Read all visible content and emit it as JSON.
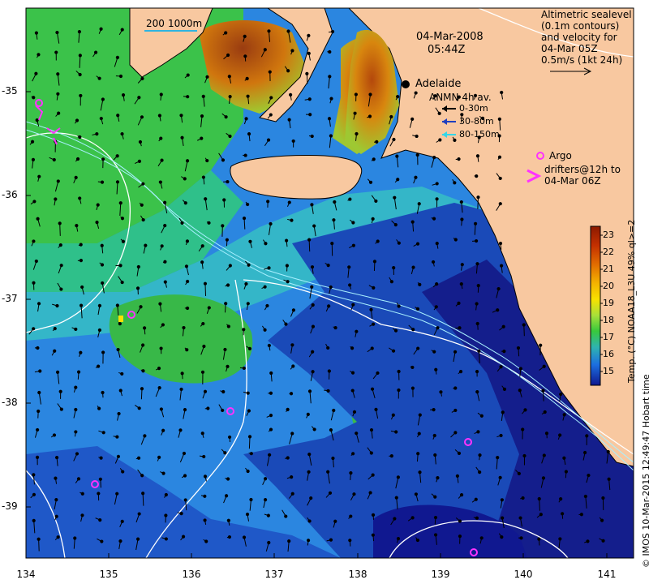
{
  "date": "04-Mar-2008",
  "time": "05:44Z",
  "scale_bar": {
    "label_km": "200",
    "label_depth": "1000m"
  },
  "city": "Adelaide",
  "altimetry": {
    "line1": "Altimetric sealevel",
    "line2": "(0.1m contours)",
    "line3": "and velocity for",
    "line4": "04-Mar 05Z",
    "line5": "0.5m/s (1kt 24h)"
  },
  "anmn": {
    "title": "ANMN 4h av.",
    "depths": [
      {
        "label": "0-30m",
        "color": "#000000"
      },
      {
        "label": "30-80m",
        "color": "#1f3fbf"
      },
      {
        "label": "80-150m",
        "color": "#33d6e8"
      }
    ]
  },
  "argo": {
    "label": "Argo",
    "drifters_line1": "drifters@12h to",
    "drifters_line2": "04-Mar 06Z",
    "color": "#ff33ff"
  },
  "colorbar": {
    "title": "Temp. (°C) NOAA18_L3U 49% ql>=2",
    "ticks": [
      "23",
      "22",
      "21",
      "20",
      "19",
      "18",
      "17",
      "16",
      "15"
    ],
    "colors": [
      "#8b1a00",
      "#c43000",
      "#e26d00",
      "#f4b400",
      "#f8e100",
      "#a8e03a",
      "#38c83c",
      "#2fb4b0",
      "#1c6fe0",
      "#101890"
    ]
  },
  "credit": "© IMOS 10-Mar-2015 12:49:47 Hobart time",
  "axes": {
    "x_ticks": [
      "134",
      "135",
      "136",
      "137",
      "138",
      "139",
      "140",
      "141"
    ],
    "y_ticks": [
      "-35",
      "-36",
      "-37",
      "-38",
      "-39"
    ],
    "lon_range": [
      134,
      141.3
    ],
    "lat_range": [
      -39.5,
      -34.3
    ]
  },
  "colors": {
    "land": "#f8c8a0",
    "ocean_cool": "#2b78e4",
    "ocean_deep": "#1530a0",
    "gulf_warm": "#c86414"
  }
}
